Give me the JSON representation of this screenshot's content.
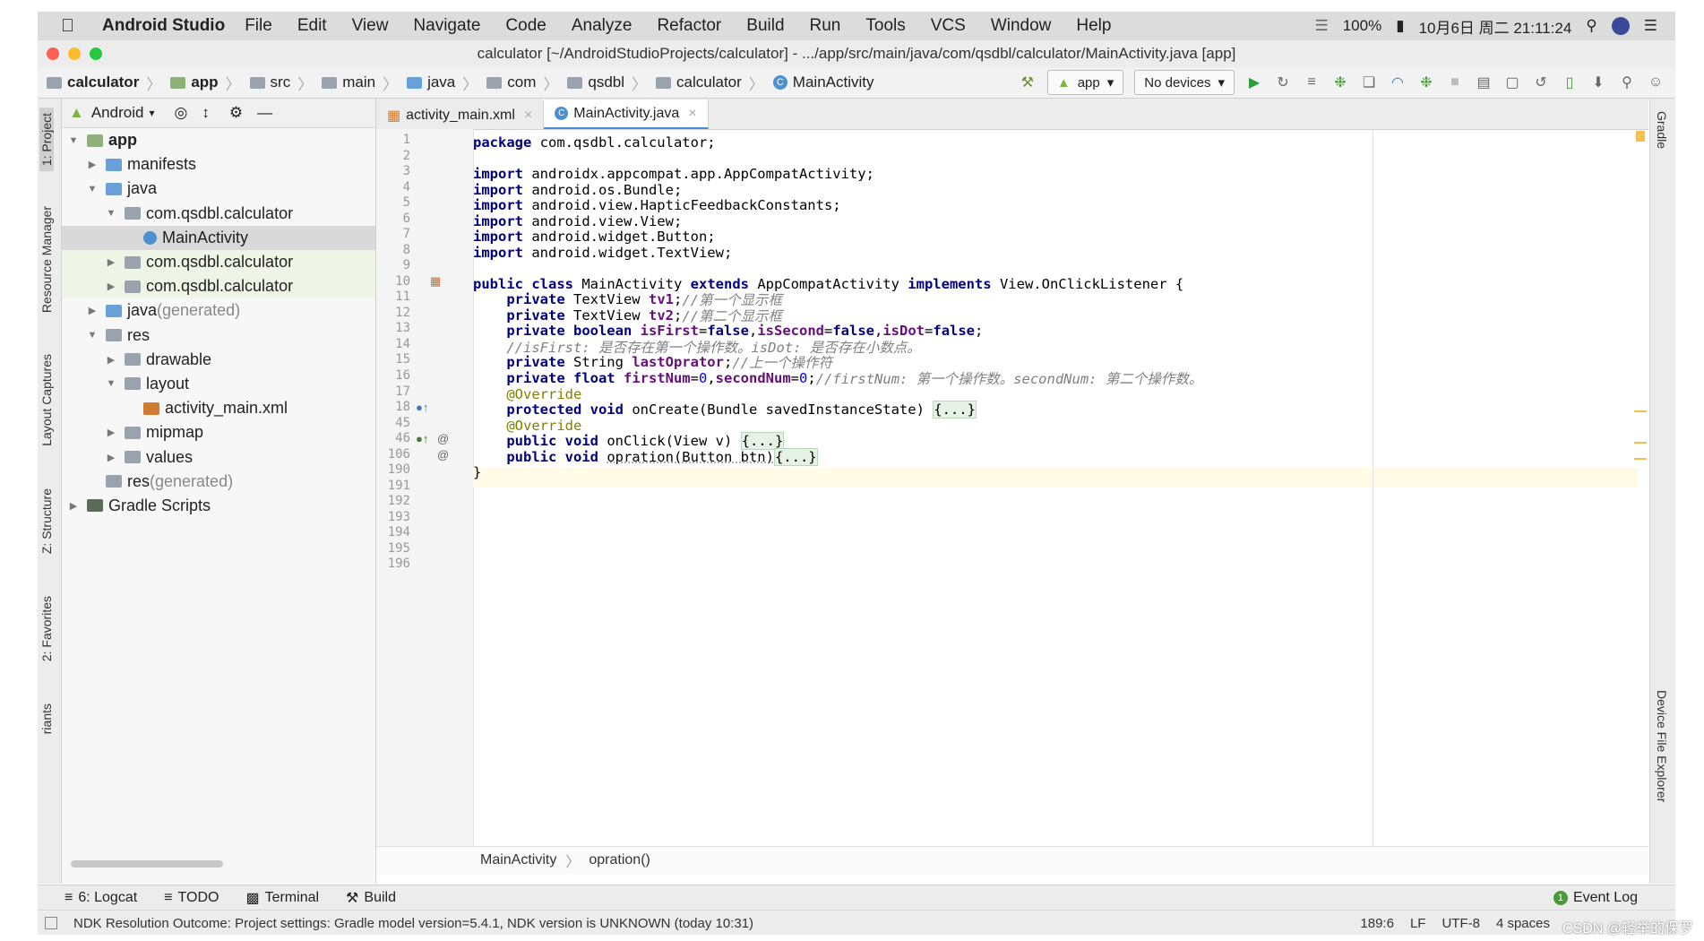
{
  "menubar": {
    "app_name": "Android Studio",
    "items": [
      "File",
      "Edit",
      "View",
      "Navigate",
      "Code",
      "Analyze",
      "Refactor",
      "Build",
      "Run",
      "Tools",
      "VCS",
      "Window",
      "Help"
    ],
    "battery": "100%",
    "datetime": "10月6日 周二 21:11:24"
  },
  "window": {
    "title": "calculator [~/AndroidStudioProjects/calculator] - .../app/src/main/java/com/qsdbl/calculator/MainActivity.java [app]"
  },
  "navbar": {
    "breadcrumbs": [
      "calculator",
      "app",
      "src",
      "main",
      "java",
      "com",
      "qsdbl",
      "calculator",
      "MainActivity"
    ],
    "run_config": "app",
    "device": "No devices"
  },
  "left_tabs": [
    "1: Project",
    "Resource Manager",
    "Layout Captures",
    "Z: Structure",
    "2: Favorites",
    "riants"
  ],
  "right_tabs": [
    "Gradle",
    "Device File Explorer"
  ],
  "project": {
    "view_mode": "Android",
    "tree": [
      {
        "label": "app",
        "level": 0,
        "arrow": "▼",
        "bold": true
      },
      {
        "label": "manifests",
        "level": 1,
        "arrow": "▶"
      },
      {
        "label": "java",
        "level": 1,
        "arrow": "▼"
      },
      {
        "label": "com.qsdbl.calculator",
        "level": 2,
        "arrow": "▼"
      },
      {
        "label": "MainActivity",
        "level": 3,
        "arrow": "",
        "selected": true
      },
      {
        "label": "com.qsdbl.calculator",
        "level": 2,
        "arrow": "▶",
        "highlight": true
      },
      {
        "label": "com.qsdbl.calculator",
        "level": 2,
        "arrow": "▶",
        "highlight": true
      },
      {
        "label": "java",
        "suffix": " (generated)",
        "level": 1,
        "arrow": "▶"
      },
      {
        "label": "res",
        "level": 1,
        "arrow": "▼"
      },
      {
        "label": "drawable",
        "level": 2,
        "arrow": "▶"
      },
      {
        "label": "layout",
        "level": 2,
        "arrow": "▼"
      },
      {
        "label": "activity_main.xml",
        "level": 3,
        "arrow": ""
      },
      {
        "label": "mipmap",
        "level": 2,
        "arrow": "▶"
      },
      {
        "label": "values",
        "level": 2,
        "arrow": "▶"
      },
      {
        "label": "res",
        "suffix": " (generated)",
        "level": 1,
        "arrow": ""
      },
      {
        "label": "Gradle Scripts",
        "level": 0,
        "arrow": "▶"
      }
    ]
  },
  "editor": {
    "tabs": [
      {
        "label": "activity_main.xml",
        "active": false
      },
      {
        "label": "MainActivity.java",
        "active": true
      }
    ],
    "line_numbers": [
      "1",
      "2",
      "3",
      "4",
      "5",
      "6",
      "7",
      "8",
      "9",
      "10",
      "11",
      "12",
      "13",
      "14",
      "15",
      "16",
      "17",
      "18",
      "45",
      "46",
      "106",
      "190",
      "191",
      "192",
      "193",
      "194",
      "195",
      "196"
    ],
    "breadcrumb": [
      "MainActivity",
      "opration()"
    ]
  },
  "code": {
    "l1": [
      "package ",
      "com.qsdbl.calculator;"
    ],
    "l3": [
      "import ",
      "androidx.appcompat.app.AppCompatActivity;"
    ],
    "l4": [
      "import ",
      "android.os.Bundle;"
    ],
    "l5": [
      "import ",
      "android.view.HapticFeedbackConstants;"
    ],
    "l6": [
      "import ",
      "android.view.View;"
    ],
    "l7": [
      "import ",
      "android.widget.Button;"
    ],
    "l8": [
      "import ",
      "android.widget.TextView;"
    ],
    "l10": [
      "public class ",
      "MainActivity ",
      "extends ",
      "AppCompatActivity ",
      "implements ",
      "View.OnClickListener {"
    ],
    "l11": [
      "    private ",
      "TextView ",
      "tv1",
      ";",
      "//第一个显示框"
    ],
    "l12": [
      "    private ",
      "TextView ",
      "tv2",
      ";",
      "//第二个显示框"
    ],
    "l13": [
      "    private boolean ",
      "isFirst",
      "=",
      "false",
      ",",
      "isSecond",
      "=",
      "false",
      ",",
      "isDot",
      "=",
      "false",
      ";"
    ],
    "l14": [
      "    //isFirst: 是否存在第一个操作数。isDot: 是否存在小数点。"
    ],
    "l15": [
      "    private ",
      "String ",
      "lastOprator",
      ";",
      "//上一个操作符"
    ],
    "l16": [
      "    private float ",
      "firstNum",
      "=",
      "0",
      ",",
      "secondNum",
      "=",
      "0",
      ";",
      "//firstNum: 第一个操作数。secondNum: 第二个操作数。"
    ],
    "l17": [
      "    @Override"
    ],
    "l18": [
      "    protected void ",
      "onCreate(Bundle savedInstanceState) ",
      "{...}"
    ],
    "l45": [
      "    @Override"
    ],
    "l46": [
      "    public void ",
      "onClick(View v) ",
      "{...}"
    ],
    "l106": [
      "    public void ",
      "opration(Button btn)",
      "{...}"
    ],
    "l190": [
      "}"
    ]
  },
  "bottom_tools": [
    "6: Logcat",
    "TODO",
    "Terminal",
    "Build"
  ],
  "event_log": "Event Log",
  "status": {
    "message": "NDK Resolution Outcome: Project settings: Gradle model version=5.4.1, NDK version is UNKNOWN (today 10:31)",
    "position": "189:6",
    "line_sep": "LF",
    "encoding": "UTF-8",
    "indent": "4 spaces"
  },
  "watermark": "CSDN @轻举的保罗"
}
